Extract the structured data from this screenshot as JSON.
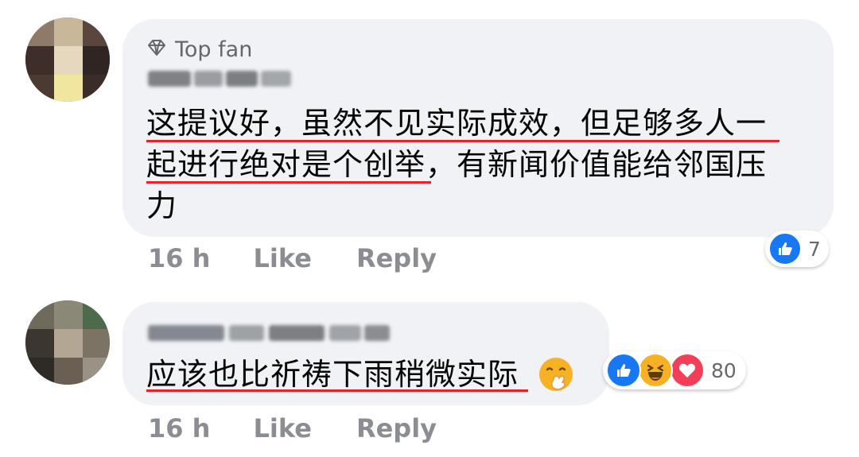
{
  "comments": [
    {
      "badge": "Top fan",
      "badge_icon": "diamond-icon",
      "author_blurred": true,
      "text_lines": [
        "这提议好，虽然不见实际成效，但足够多人一",
        "起进行绝对是个创举，有新闻价值能给邻国压",
        "力"
      ],
      "time": "16 h",
      "like_label": "Like",
      "reply_label": "Reply",
      "reactions": {
        "icons": [
          "like-icon"
        ],
        "count": "7"
      }
    },
    {
      "author_blurred": true,
      "text": "应该也比祈祷下雨稍微实际",
      "emoji": "face-with-hand-over-mouth-emoji",
      "time": "16 h",
      "like_label": "Like",
      "reply_label": "Reply",
      "reactions": {
        "icons": [
          "like-icon",
          "haha-icon",
          "love-icon"
        ],
        "count": "80"
      }
    }
  ],
  "colors": {
    "bubble": "#f0f2f5",
    "meta": "#8a8d91",
    "like_blue": "#1877f2",
    "love_red": "#f33e58",
    "haha_yellow": "#f7b125",
    "underline": "#e8212b"
  }
}
